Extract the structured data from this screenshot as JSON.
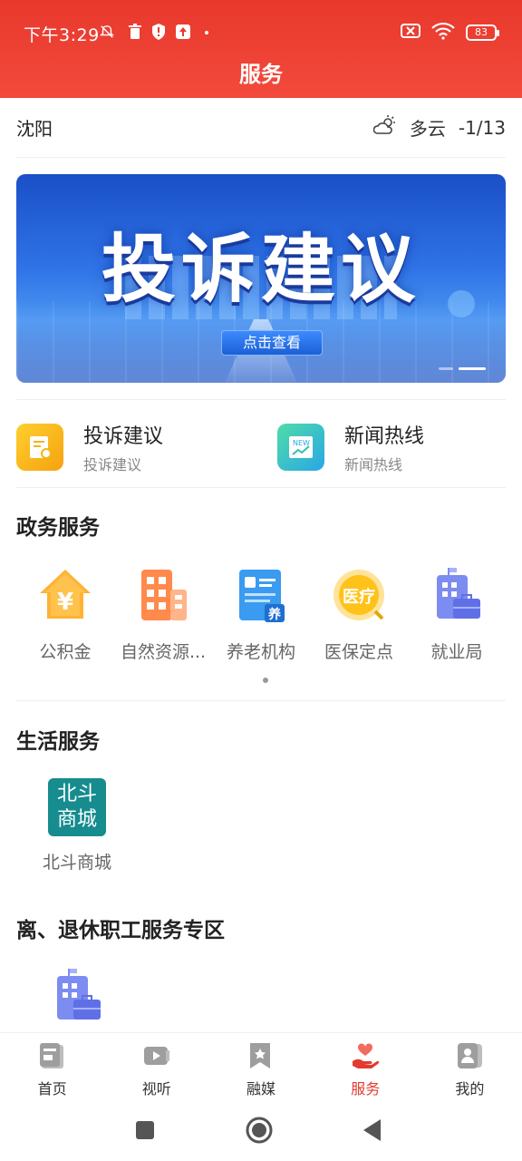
{
  "status_bar": {
    "time": "下午3:29",
    "battery": "83"
  },
  "header": {
    "title": "服务"
  },
  "weather": {
    "city": "沈阳",
    "condition": "多云",
    "temperature": "-1/13",
    "icon": "cloud-sun-icon"
  },
  "banner": {
    "headline": "投诉建议",
    "cta": "点击查看",
    "page_count": 2,
    "active_page": 2
  },
  "quick_entries": [
    {
      "title": "投诉建议",
      "subtitle": "投诉建议",
      "icon": "complaint-icon",
      "color": "#f5b40f"
    },
    {
      "title": "新闻热线",
      "subtitle": "新闻热线",
      "icon": "news-icon",
      "color": "#2ec2c8"
    }
  ],
  "gov_services": {
    "title": "政务服务",
    "items": [
      {
        "label": "公积金",
        "icon": "housing-fund-icon"
      },
      {
        "label": "自然资源...",
        "icon": "building-icon"
      },
      {
        "label": "养老机构",
        "icon": "elderly-care-icon"
      },
      {
        "label": "医保定点",
        "icon": "medical-insurance-icon"
      },
      {
        "label": "就业局",
        "icon": "employment-icon"
      }
    ]
  },
  "life_services": {
    "title": "生活服务",
    "items": [
      {
        "label": "北斗商城",
        "logo_text": "北斗商城",
        "icon": "beidou-mall-logo"
      }
    ]
  },
  "retiree_services": {
    "title": "离、退休职工服务专区"
  },
  "bottom_nav": [
    {
      "label": "首页",
      "icon": "home-news-icon",
      "active": false
    },
    {
      "label": "视听",
      "icon": "video-icon",
      "active": false
    },
    {
      "label": "融媒",
      "icon": "media-bookmark-icon",
      "active": false
    },
    {
      "label": "服务",
      "icon": "service-heart-icon",
      "active": true
    },
    {
      "label": "我的",
      "icon": "profile-icon",
      "active": false
    }
  ],
  "colors": {
    "brand": "#e8382c",
    "active_tab": "#e43a2f"
  }
}
